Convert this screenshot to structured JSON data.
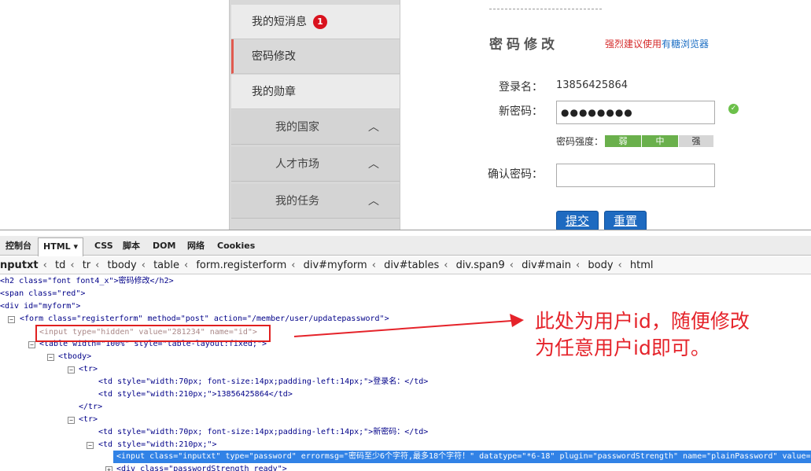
{
  "sidebar": {
    "messages": "我的短消息",
    "badge": "1",
    "password": "密码修改",
    "medals": "我的勋章",
    "country": "我的国家",
    "talent": "人才市场",
    "tasks": "我的任务",
    "chevron": "chevron-up-icon"
  },
  "form": {
    "title": "密码修改",
    "note_red": "强烈建议使用",
    "note_blue": "有糖浏览器",
    "login_label": "登录名：",
    "login_value": "13856425864",
    "newpwd_label": "新密码：",
    "newpwd_value": "●●●●●●●●",
    "strength_label": "密码强度：",
    "weak": "弱",
    "medium": "中",
    "strong": "强",
    "confirm_label": "确认密码：",
    "submit": "提交",
    "reset": "重置",
    "ok_icon": "check-icon"
  },
  "devtools": {
    "tabs": [
      "控制台",
      "HTML ▾",
      "CSS",
      "脚本",
      "DOM",
      "网络",
      "Cookies"
    ],
    "breadcrumbs": [
      "nputxt",
      "td",
      "tr",
      "tbody",
      "table",
      "form.registerform",
      "div#myform",
      "div#tables",
      "div.span9",
      "div#main",
      "body",
      "html"
    ],
    "lines": {
      "l1": "<h2 class=\"font font4_x\">密码修改</h2>",
      "l2": "<span class=\"red\">",
      "l3": "<div id=\"myform\">",
      "l4": "<form class=\"registerform\" method=\"post\" action=\"/member/user/updatepassword\">",
      "l5": "<input type=\"hidden\" value=\"281234\" name=\"id\">",
      "l6": "<table width=\"100%\" style=\"table-layout:fixed;\">",
      "l7": "<tbody>",
      "l8": "<tr>",
      "l9": "<td style=\"width:70px; font-size:14px;padding-left:14px;\">登录名：</td>",
      "l10": "<td style=\"width:210px;\">13856425864</td>",
      "l11": "</tr>",
      "l12": "<tr>",
      "l13": "<td style=\"width:70px; font-size:14px;padding-left:14px;\">新密码：</td>",
      "l14": "<td style=\"width:210px;\">",
      "l15": "<input class=\"inputxt\" type=\"password\" errormsg=\"密码至少6个字符,最多18个字符！\" datatype=\"*6-18\" plugin=\"passwordStrength\" name=\"plainPassword\" value=\"\">",
      "l16": "<div class=\"passwordStrength ready\">"
    }
  },
  "annotation": {
    "line1": "此处为用户id，随便修改",
    "line2": "为任意用户id即可。",
    "color": "#e5232a"
  }
}
